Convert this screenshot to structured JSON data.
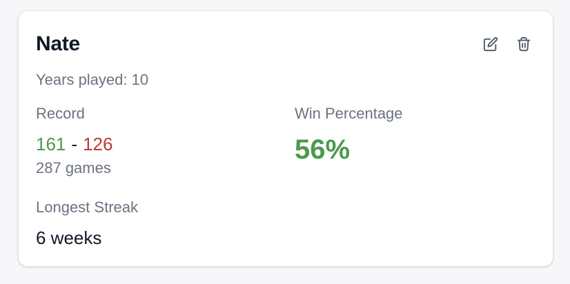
{
  "player": {
    "name": "Nate",
    "years_played": "Years played: 10"
  },
  "record": {
    "label": "Record",
    "wins": "161",
    "separator": "-",
    "losses": "126",
    "games": "287 games"
  },
  "win_percentage": {
    "label": "Win Percentage",
    "value": "56%"
  },
  "streak": {
    "label": "Longest Streak",
    "value": "6 weeks"
  },
  "actions": {
    "edit_icon": "edit-icon",
    "delete_icon": "trash-icon"
  },
  "colors": {
    "wins": "#4a9a4a",
    "losses": "#c0392b",
    "win_percentage": "#4a9a4a"
  }
}
